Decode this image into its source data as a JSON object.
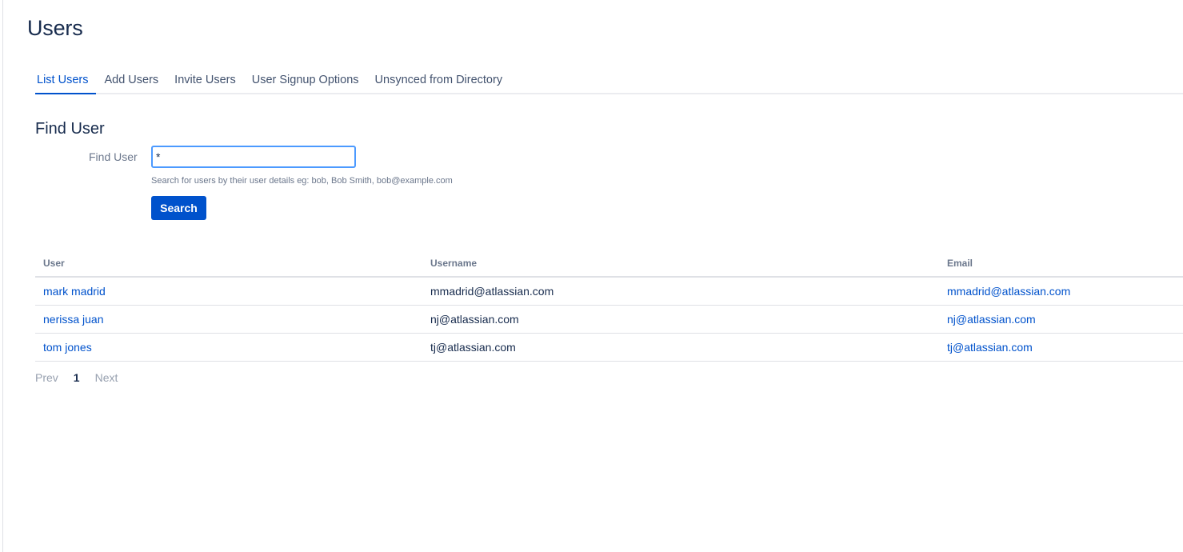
{
  "page": {
    "title": "Users"
  },
  "tabs": [
    {
      "label": "List Users",
      "active": true
    },
    {
      "label": "Add Users",
      "active": false
    },
    {
      "label": "Invite Users",
      "active": false
    },
    {
      "label": "User Signup Options",
      "active": false
    },
    {
      "label": "Unsynced from Directory",
      "active": false
    }
  ],
  "find": {
    "section_title": "Find User",
    "label": "Find User",
    "value": "*",
    "hint": "Search for users by their user details eg: bob, Bob Smith, bob@example.com",
    "button_label": "Search"
  },
  "table": {
    "headers": [
      "User",
      "Username",
      "Email"
    ],
    "rows": [
      {
        "user": "mark madrid",
        "username": "mmadrid@atlassian.com",
        "email": "mmadrid@atlassian.com"
      },
      {
        "user": "nerissa juan",
        "username": "nj@atlassian.com",
        "email": "nj@atlassian.com"
      },
      {
        "user": "tom jones",
        "username": "tj@atlassian.com",
        "email": "tj@atlassian.com"
      }
    ]
  },
  "pager": {
    "prev": "Prev",
    "current": "1",
    "next": "Next"
  },
  "colors": {
    "accent": "#0052cc",
    "text": "#172b4d",
    "muted": "#6b778c",
    "focus": "#4c9aff"
  }
}
